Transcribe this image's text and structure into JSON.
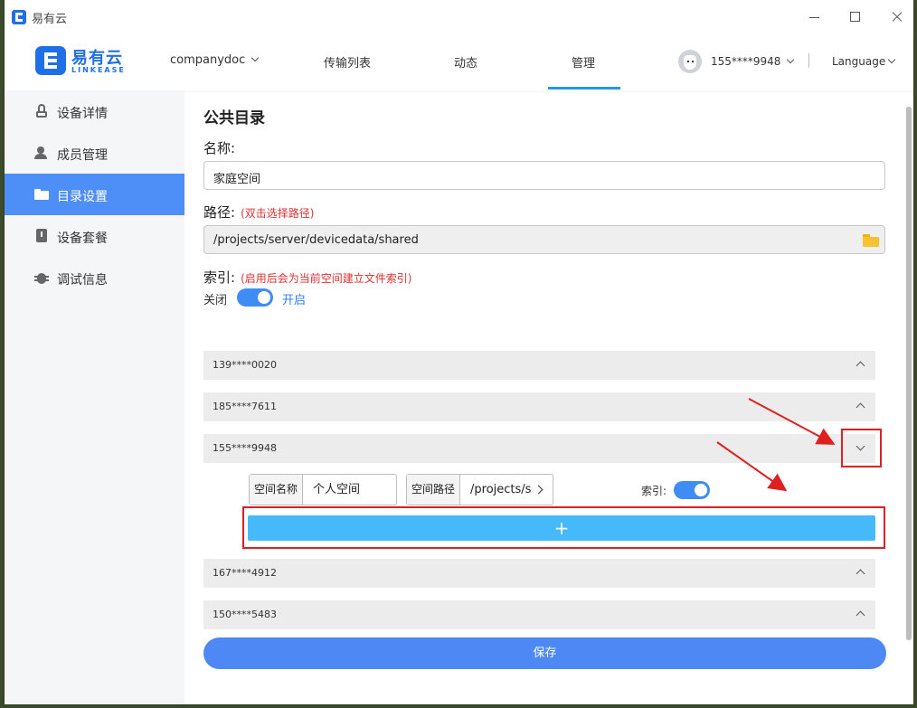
{
  "window": {
    "title": "易有云"
  },
  "header": {
    "logo_cn": "易有云",
    "logo_en": "LINKEASE",
    "nav": {
      "companydoc": "companydoc",
      "transfer": "传输列表",
      "activity": "动态",
      "manage": "管理"
    },
    "user_phone": "155****9948",
    "language": "Language"
  },
  "sidebar": {
    "items": [
      {
        "label": "设备详情",
        "icon": "router-icon"
      },
      {
        "label": "成员管理",
        "icon": "users-icon"
      },
      {
        "label": "目录设置",
        "icon": "folder-icon"
      },
      {
        "label": "设备套餐",
        "icon": "plan-icon"
      },
      {
        "label": "调试信息",
        "icon": "bug-icon"
      }
    ],
    "active_index": 2
  },
  "main": {
    "title": "公共目录",
    "name_label": "名称:",
    "name_value": "家庭空间",
    "path_label": "路径:",
    "path_hint": "(双击选择路径)",
    "path_value": "/projects/server/devicedata/shared",
    "index_label": "索引:",
    "index_hint": "(启用后会为当前空间建立文件索引)",
    "toggle_off": "关闭",
    "toggle_on": "开启",
    "members": [
      {
        "phone": "139****0020",
        "expanded": false
      },
      {
        "phone": "185****7611",
        "expanded": false
      },
      {
        "phone": "155****9948",
        "expanded": true
      },
      {
        "phone": "167****4912",
        "expanded": false
      },
      {
        "phone": "150****5483",
        "expanded": false
      }
    ],
    "space": {
      "name_caption": "空间名称",
      "name_value": "个人空间",
      "path_caption": "空间路径",
      "path_value": "/projects/s",
      "index_label": "索引:"
    },
    "add_label": "+",
    "save_label": "保存"
  },
  "colors": {
    "accent": "#4e88f4",
    "add_button": "#45b9f9",
    "annotation": "#e02020",
    "hint": "#e03030"
  }
}
